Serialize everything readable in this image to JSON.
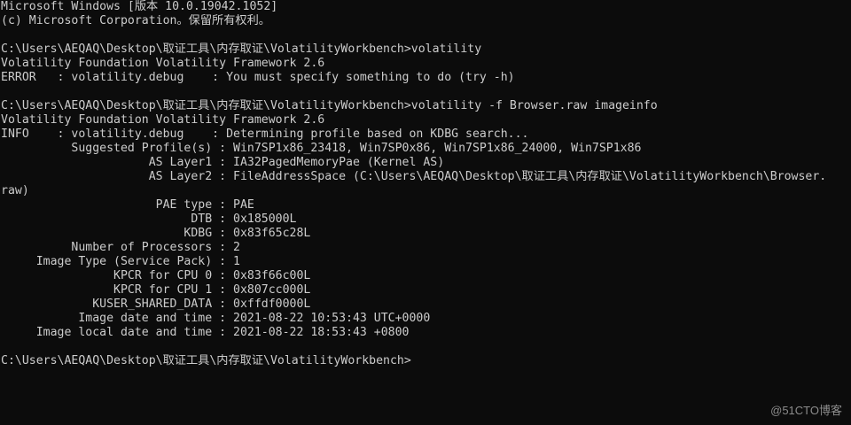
{
  "window": {
    "lines": [
      "Microsoft Windows [版本 10.0.19042.1052]",
      "(c) Microsoft Corporation。保留所有权利。",
      "",
      "C:\\Users\\AEQAQ\\Desktop\\取证工具\\内存取证\\VolatilityWorkbench>volatility",
      "Volatility Foundation Volatility Framework 2.6",
      "ERROR   : volatility.debug    : You must specify something to do (try -h)",
      "",
      "C:\\Users\\AEQAQ\\Desktop\\取证工具\\内存取证\\VolatilityWorkbench>volatility -f Browser.raw imageinfo",
      "Volatility Foundation Volatility Framework 2.6",
      "INFO    : volatility.debug    : Determining profile based on KDBG search...",
      "          Suggested Profile(s) : Win7SP1x86_23418, Win7SP0x86, Win7SP1x86_24000, Win7SP1x86",
      "                     AS Layer1 : IA32PagedMemoryPae (Kernel AS)",
      "                     AS Layer2 : FileAddressSpace (C:\\Users\\AEQAQ\\Desktop\\取证工具\\内存取证\\VolatilityWorkbench\\Browser.",
      "raw)",
      "                      PAE type : PAE",
      "                           DTB : 0x185000L",
      "                          KDBG : 0x83f65c28L",
      "          Number of Processors : 2",
      "     Image Type (Service Pack) : 1",
      "                KPCR for CPU 0 : 0x83f66c00L",
      "                KPCR for CPU 1 : 0x807cc000L",
      "             KUSER_SHARED_DATA : 0xffdf0000L",
      "           Image date and time : 2021-08-22 10:53:43 UTC+0000",
      "     Image local date and time : 2021-08-22 18:53:43 +0800",
      "",
      "C:\\Users\\AEQAQ\\Desktop\\取证工具\\内存取证\\VolatilityWorkbench>"
    ]
  },
  "watermark": "@51CTO博客",
  "colors": {
    "background": "#0c0c0c",
    "text": "#cccccc"
  }
}
